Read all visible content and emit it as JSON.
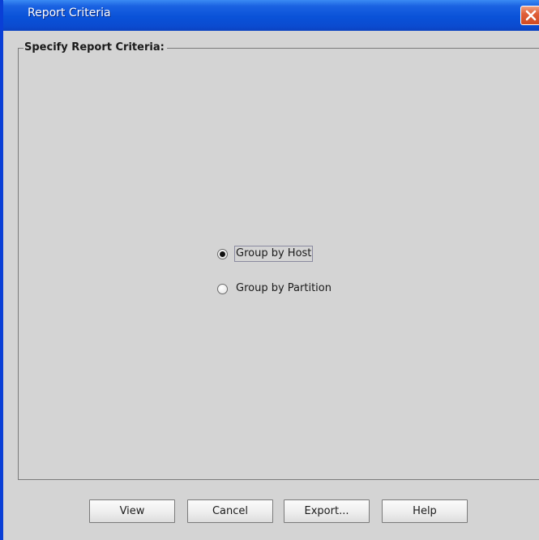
{
  "window": {
    "title": "Report Criteria"
  },
  "groupbox": {
    "title": "Specify Report Criteria:"
  },
  "options": [
    {
      "label": "Group by Host",
      "selected": true
    },
    {
      "label": "Group by Partition",
      "selected": false
    }
  ],
  "buttons": {
    "view": "View",
    "cancel": "Cancel",
    "export": "Export...",
    "help": "Help"
  },
  "colors": {
    "titlebar": "#0a52d8",
    "close_button": "#d14a22",
    "dialog_background": "#d4d4d4"
  }
}
